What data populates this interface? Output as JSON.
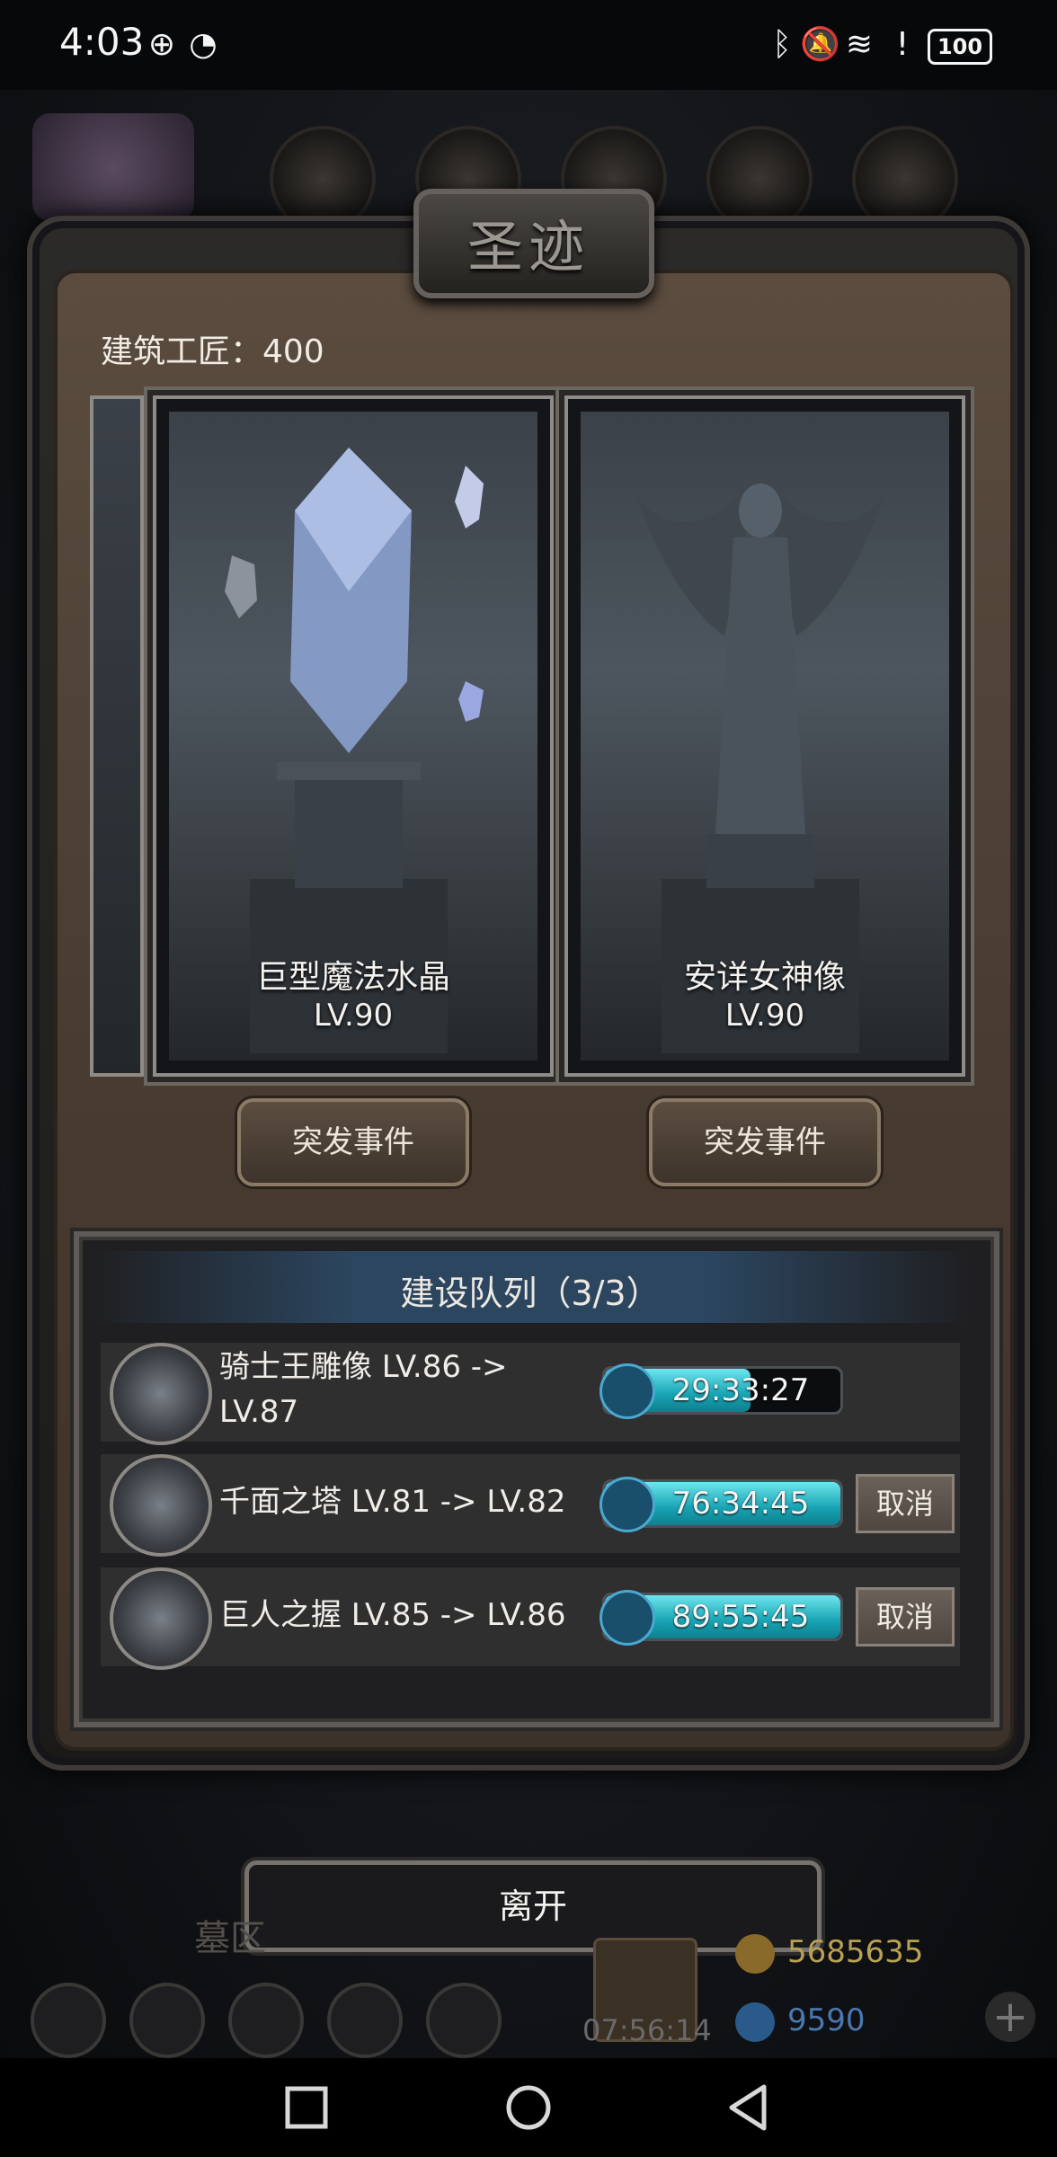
{
  "status_bar": {
    "time": "4:03",
    "battery": "100"
  },
  "dialog": {
    "title": "圣迹",
    "artisans": "建筑工匠：400",
    "cards": [
      {
        "name": "巨型魔法水晶",
        "level": "LV.90",
        "event_label": "突发事件"
      },
      {
        "name": "安详女神像",
        "level": "LV.90",
        "event_label": "突发事件"
      }
    ],
    "queue": {
      "title": "建设队列（3/3）",
      "items": [
        {
          "text_line1": "骑士王雕像 LV.86 ->",
          "text_line2": "LV.87",
          "timer": "29:33:27",
          "progress": 0.62
        },
        {
          "text_line1": "千面之塔 LV.81 -> LV.82",
          "text_line2": "",
          "timer": "76:34:45",
          "progress": 1.0,
          "cancel_label": "取消"
        },
        {
          "text_line1": "巨人之握 LV.85 -> LV.86",
          "text_line2": "",
          "timer": "89:55:45",
          "progress": 1.0,
          "cancel_label": "取消"
        }
      ]
    },
    "leave_label": "离开"
  },
  "hud": {
    "gold": "5685635",
    "gems": "9590",
    "timer": "07:56:14",
    "area_label": "墓区"
  },
  "icons": {
    "nav_recent": "square-icon",
    "nav_home": "circle-icon",
    "nav_back": "triangle-back-icon"
  }
}
